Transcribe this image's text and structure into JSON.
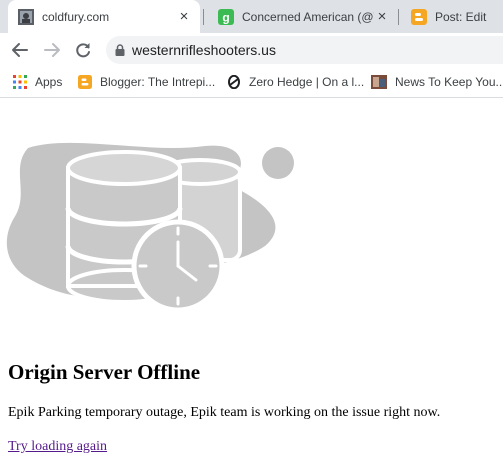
{
  "browser": {
    "tabs": [
      {
        "title": "coldfury.com",
        "icon": "site-photo-favicon",
        "active": true
      },
      {
        "title": "Concerned American (@W",
        "icon": "green-g-favicon",
        "active": false
      },
      {
        "title": "Post: Edit",
        "icon": "blogger-favicon",
        "active": false
      }
    ],
    "close_glyph": "×",
    "url": "westernrifleshooters.us",
    "bookmarks": [
      {
        "label": "Apps",
        "icon": "apps-grid-icon"
      },
      {
        "label": "Blogger: The Intrepi...",
        "icon": "blogger-favicon"
      },
      {
        "label": "Zero Hedge | On a l...",
        "icon": "zerohedge-favicon"
      },
      {
        "label": "News To Keep You...",
        "icon": "photo-favicon"
      }
    ]
  },
  "page": {
    "heading": "Origin Server Offline",
    "message": "Epik Parking temporary outage, Epik team is working on the issue right now.",
    "retry_link": "Try loading again"
  },
  "colors": {
    "tabstrip": "#dee1e6",
    "omnibox": "#f1f3f4",
    "illustration": "#c4c4c4",
    "link_visited": "#551a8b",
    "blogger_orange": "#f5a623",
    "green_g": "#3cba54"
  }
}
